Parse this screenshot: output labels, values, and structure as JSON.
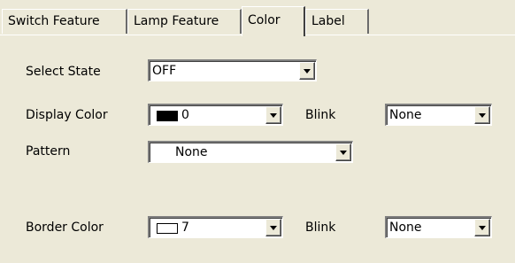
{
  "tabs": [
    {
      "label": "Switch Feature"
    },
    {
      "label": "Lamp Feature"
    },
    {
      "label": "Color"
    },
    {
      "label": "Label"
    }
  ],
  "active_tab": "Color",
  "form": {
    "select_state": {
      "label": "Select State",
      "value": "OFF"
    },
    "display_color": {
      "label": "Display Color",
      "value": "0",
      "swatch": "#000000"
    },
    "display_blink": {
      "label": "Blink",
      "value": "None"
    },
    "pattern": {
      "label": "Pattern",
      "value": "None"
    },
    "border_color": {
      "label": "Border Color",
      "value": "7",
      "swatch": "#ffffff"
    },
    "border_blink": {
      "label": "Blink",
      "value": "None"
    }
  }
}
